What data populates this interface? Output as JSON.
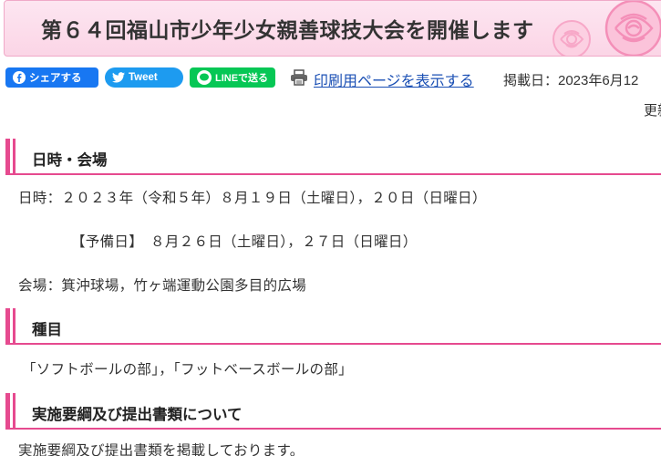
{
  "page_title": "第６４回福山市少年少女親善球技大会を開催します",
  "share": {
    "facebook_label": "シェアする",
    "twitter_label": "Tweet",
    "line_label": "LINEで送る"
  },
  "print_link_label": "印刷用ページを表示する",
  "post_date": "掲載日：2023年6月12",
  "updated_label": "更新",
  "sections": [
    {
      "heading": "日時・会場",
      "lines": [
        "日時：２０２３年（令和５年）８月１９日（土曜日），２０日（日曜日）",
        "【予備日】　８月２６日（土曜日），２７日（日曜日）",
        "会場：箕沖球場，竹ヶ端運動公園多目的広場"
      ]
    },
    {
      "heading": "種目",
      "lines": [
        "「ソフトボールの部」，「フットベースボールの部」"
      ]
    },
    {
      "heading": "実施要綱及び提出書類について",
      "lines": [
        "実施要綱及び提出書類を掲載しております。"
      ]
    }
  ],
  "colors": {
    "accent_pink": "#e64a8f",
    "banner_bg": "#fbd5e6",
    "facebook": "#1877f2",
    "twitter": "#1d9bf0",
    "line": "#06c755",
    "link": "#1a4fb4"
  },
  "icons": [
    "facebook-icon",
    "twitter-icon",
    "line-icon",
    "printer-icon",
    "rose-decoration"
  ]
}
